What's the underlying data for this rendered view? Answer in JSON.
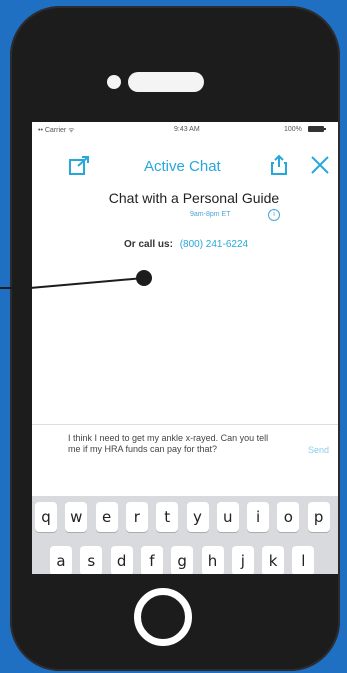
{
  "status_bar": {
    "carrier": "•• Carrier ᯤ",
    "time": "9:43 AM",
    "battery": "100%"
  },
  "nav": {
    "title": "Active Chat",
    "compose_icon": "compose-icon",
    "share_icon": "share-icon",
    "close_icon": "close-icon"
  },
  "chat": {
    "heading": "Chat with a Personal Guide",
    "hours": "9am-8pm ET",
    "info_symbol": "i",
    "call_label": "Or call us:",
    "call_number": "(800) 241-6224"
  },
  "message": {
    "text": "I think I need to get my ankle x-rayed. Can you tell me if my HRA funds can pay for that?",
    "send_label": "Send"
  },
  "keyboard": {
    "row1": [
      "q",
      "w",
      "e",
      "r",
      "t",
      "y",
      "u",
      "i",
      "o",
      "p"
    ],
    "row2": [
      "a",
      "s",
      "d",
      "f",
      "g",
      "h",
      "j",
      "k",
      "l"
    ]
  },
  "colors": {
    "background": "#1f6fc2",
    "accent": "#27a8da",
    "phone_body": "#1c1c1d"
  }
}
